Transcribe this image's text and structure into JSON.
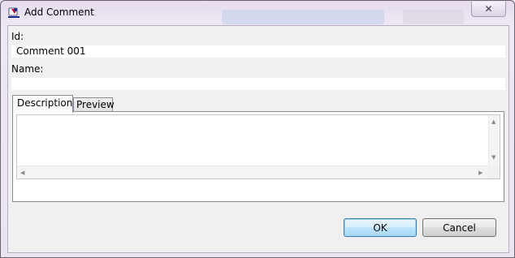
{
  "window": {
    "title": "Add Comment",
    "close_glyph": "✕",
    "icon": "app-logo-icon"
  },
  "form": {
    "id_label": "Id:",
    "id_value": "Comment 001",
    "name_label": "Name:",
    "name_value": ""
  },
  "tabs": [
    {
      "label": "Description",
      "active": true
    },
    {
      "label": "Preview",
      "active": false
    }
  ],
  "description": {
    "value": ""
  },
  "buttons": {
    "ok_label": "OK",
    "cancel_label": "Cancel"
  },
  "icons": {
    "scroll_up": "▲",
    "scroll_down": "▼",
    "scroll_left": "◀",
    "scroll_right": "▶"
  },
  "colors": {
    "frame_background": "#ede6f2",
    "client_background": "#f0f0f0",
    "default_button_border": "#3c7fb1"
  }
}
